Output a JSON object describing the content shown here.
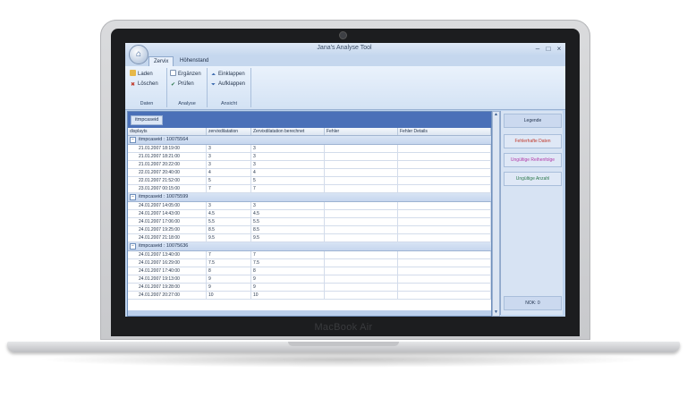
{
  "device": {
    "brand": "MacBook Air"
  },
  "window": {
    "title": "Jana's Analyse Tool",
    "controls": [
      "–",
      "□",
      "×"
    ]
  },
  "tabs": [
    {
      "label": "Zervix",
      "active": true
    },
    {
      "label": "Höhenstand",
      "active": false
    }
  ],
  "ribbon": {
    "groups": [
      {
        "label": "Daten",
        "buttons": [
          {
            "label": "Laden",
            "icon": "folder-icon"
          },
          {
            "label": "Löschen",
            "icon": "delete-icon"
          }
        ]
      },
      {
        "label": "Analyse",
        "buttons": [
          {
            "label": "Ergänzen",
            "icon": "add-icon"
          },
          {
            "label": "Prüfen",
            "icon": "check-icon"
          }
        ]
      },
      {
        "label": "Ansicht",
        "buttons": [
          {
            "label": "Einklappen",
            "icon": "collapse-icon"
          },
          {
            "label": "Aufklappen",
            "icon": "expand-icon"
          }
        ]
      }
    ]
  },
  "grid": {
    "group_chip": "itmpcaseid",
    "columns": [
      "displayts",
      "zervixdilatation",
      "Zervixdilatation berechnet",
      "Fehler",
      "Fehler Details"
    ],
    "groups": [
      {
        "label": "itmpcaseid : 10075564",
        "rows": [
          [
            "21.01.2007 18:19:00",
            "3",
            "3",
            "",
            ""
          ],
          [
            "21.01.2007 18:21:00",
            "3",
            "3",
            "",
            ""
          ],
          [
            "21.01.2007 20:22:00",
            "3",
            "3",
            "",
            ""
          ],
          [
            "22.01.2007 20:40:00",
            "4",
            "4",
            "",
            ""
          ],
          [
            "22.01.2007 21:52:00",
            "5",
            "5",
            "",
            ""
          ],
          [
            "23.01.2007 00:15:00",
            "7",
            "7",
            "",
            ""
          ]
        ]
      },
      {
        "label": "itmpcaseid : 10075599",
        "rows": [
          [
            "24.01.2007 14:05:00",
            "3",
            "3",
            "",
            ""
          ],
          [
            "24.01.2007 14:43:00",
            "4.5",
            "4.5",
            "",
            ""
          ],
          [
            "24.01.2007 17:06:00",
            "5.5",
            "5.5",
            "",
            ""
          ],
          [
            "24.01.2007 19:25:00",
            "8.5",
            "8.5",
            "",
            ""
          ],
          [
            "24.01.2007 21:18:00",
            "9.5",
            "9.5",
            "",
            ""
          ]
        ]
      },
      {
        "label": "itmpcaseid : 10075636",
        "rows": [
          [
            "24.01.2007 13:40:00",
            "7",
            "7",
            "",
            ""
          ],
          [
            "24.01.2007 16:29:00",
            "7.5",
            "7.5",
            "",
            ""
          ],
          [
            "24.01.2007 17:40:00",
            "8",
            "8",
            "",
            ""
          ],
          [
            "24.01.2007 19:13:00",
            "9",
            "9",
            "",
            ""
          ],
          [
            "24.01.2007 19:28:00",
            "9",
            "9",
            "",
            ""
          ],
          [
            "24.01.2007 20:27:00",
            "10",
            "10",
            "",
            ""
          ]
        ]
      }
    ]
  },
  "legend": {
    "title": "Legende",
    "items": [
      {
        "label": "Fehlerhafte Daten",
        "color": "#c0392b"
      },
      {
        "label": "Ungültige Reihenfolge",
        "color": "#b23aa8"
      },
      {
        "label": "Ungültige Anzahl",
        "color": "#2f7a4f"
      }
    ],
    "status": "NOK: 0"
  }
}
